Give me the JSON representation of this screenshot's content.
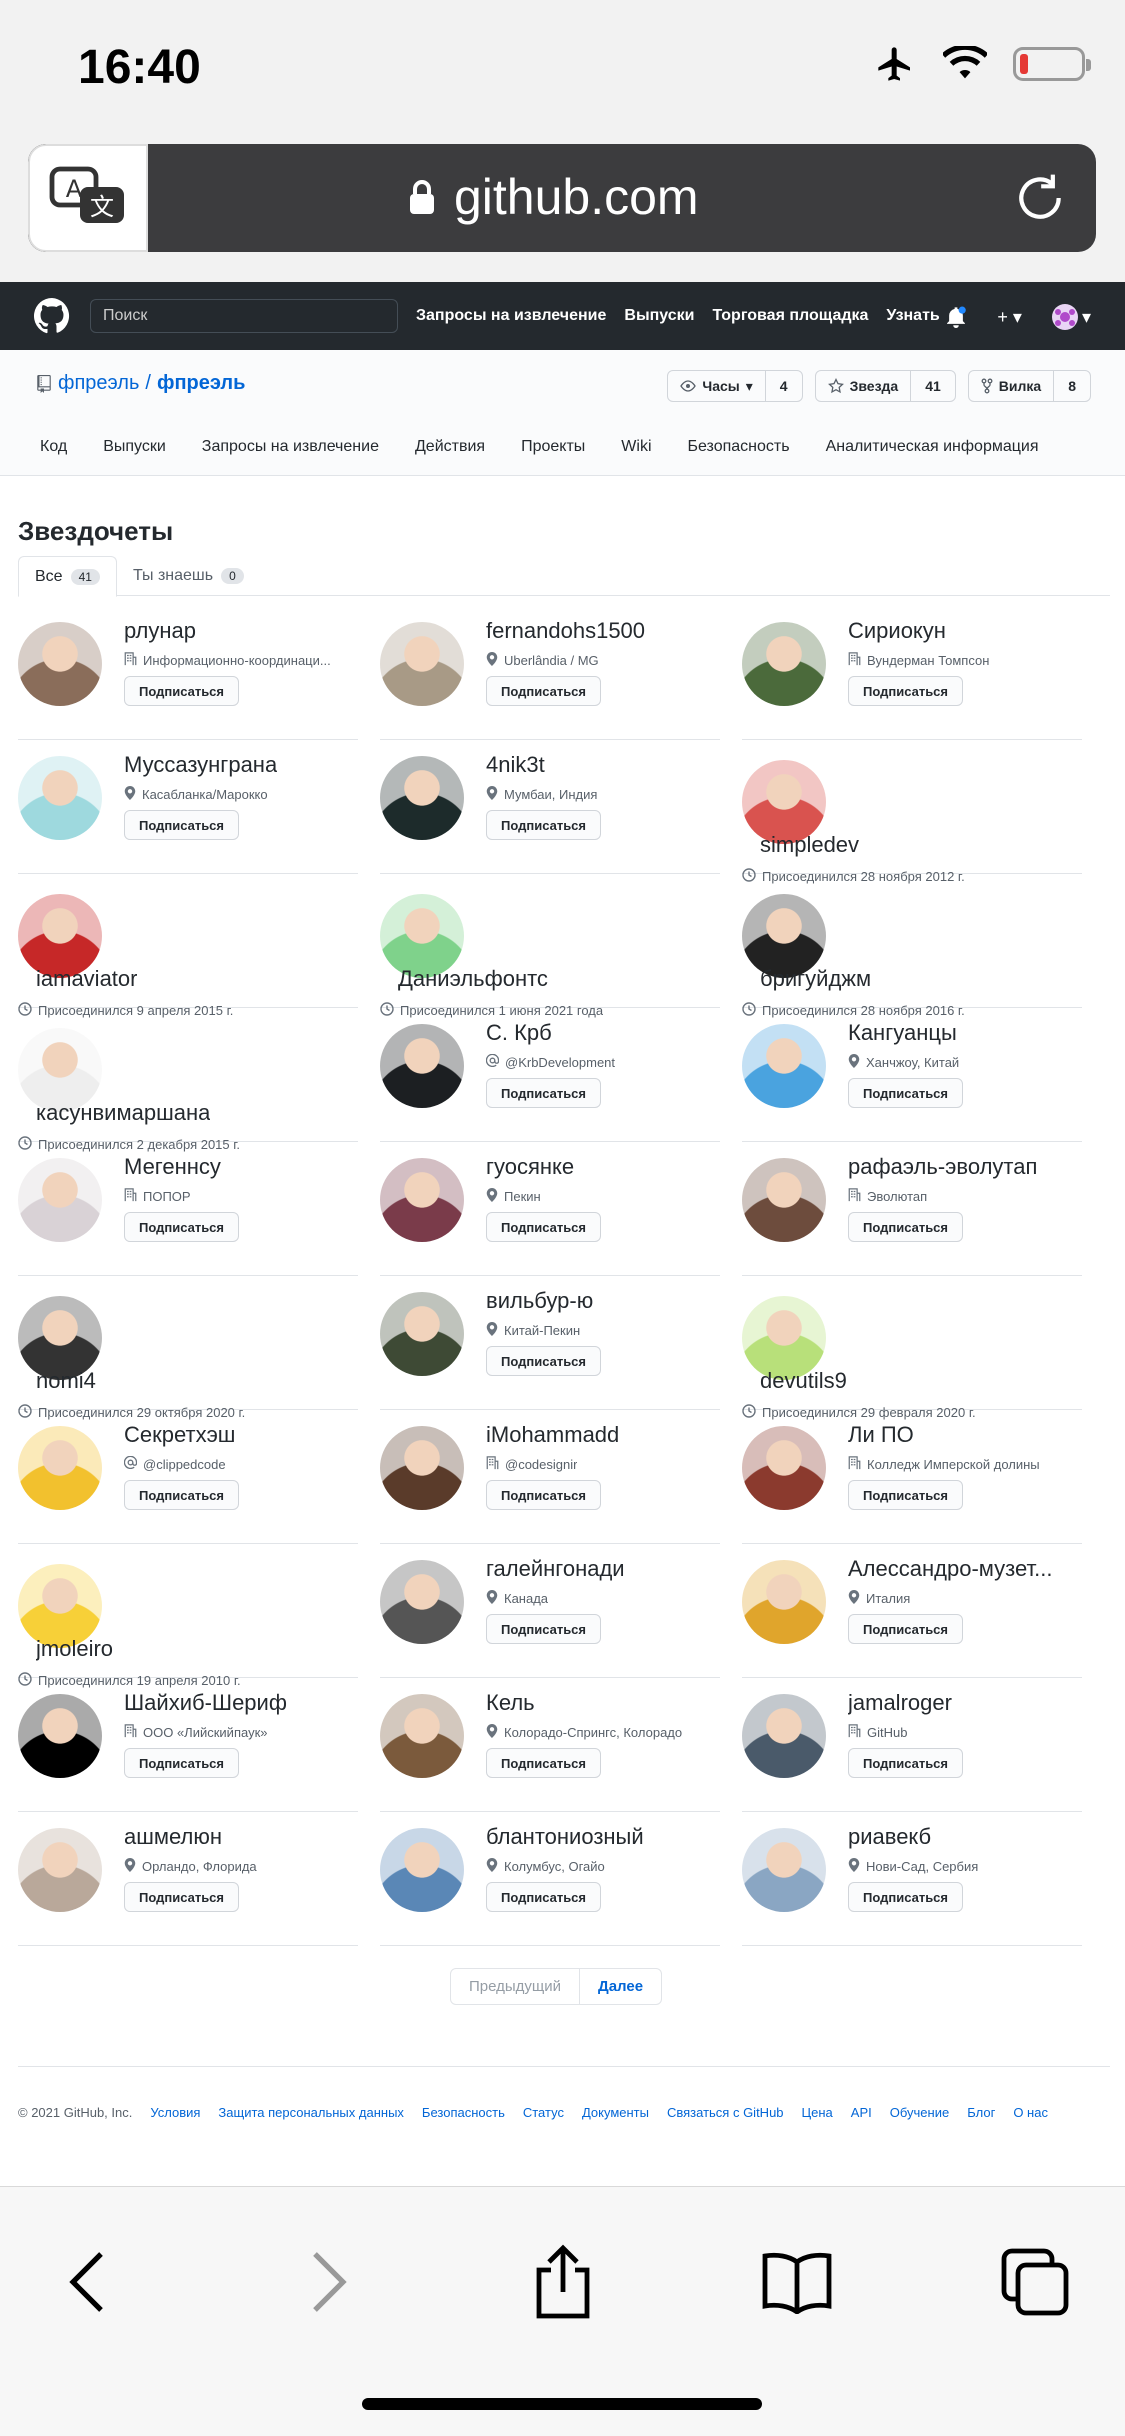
{
  "status": {
    "time": "16:40"
  },
  "browser": {
    "url": "github.com"
  },
  "gh": {
    "search_placeholder": "Поиск",
    "nav": [
      "Запросы на извлечение",
      "Выпуски",
      "Торговая площадка",
      "Узнать"
    ]
  },
  "repo": {
    "owner": "фпреэль",
    "sep": "/",
    "name": "фпреэль",
    "watch": {
      "label": "Часы",
      "count": "4"
    },
    "star": {
      "label": "Звезда",
      "count": "41"
    },
    "fork": {
      "label": "Вилка",
      "count": "8"
    },
    "tabs": [
      "Код",
      "Выпуски",
      "Запросы на извлечение",
      "Действия",
      "Проекты",
      "Wiki",
      "Безопасность",
      "Аналитическая информация"
    ]
  },
  "page": {
    "title": "Звездочеты",
    "tab_all": "Все",
    "tab_all_count": "41",
    "tab_known": "Ты знаешь",
    "tab_known_count": "0",
    "follow_label": "Подписаться"
  },
  "users": [
    {
      "name": "рлунар",
      "meta": "Информационно-координаци...",
      "meta_icon": "org",
      "color": "#8a6d5a"
    },
    {
      "name": "fernandohs1500",
      "meta": "Uberlândia / MG",
      "meta_icon": "loc",
      "color": "#a89a86"
    },
    {
      "name": "Сириокун",
      "meta": "Вундерман Томпсон",
      "meta_icon": "org",
      "color": "#4b6a3b"
    },
    {
      "name": "Муссазунграна",
      "meta": "Касабланка/Марокко",
      "meta_icon": "loc",
      "color": "#9ed9de"
    },
    {
      "name": "4nik3t",
      "meta": "Мумбаи, Индия",
      "meta_icon": "loc",
      "color": "#1d2b2b"
    },
    {
      "name": "simpledev",
      "meta": "Присоединился 28 ноября 2012 г.",
      "meta_icon": "clock",
      "color": "#d9534f"
    },
    {
      "name": "iamaviator",
      "meta": "Присоединился 9 апреля 2015 г.",
      "meta_icon": "clock",
      "color": "#c62828"
    },
    {
      "name": "Даниэльфонтс",
      "meta": "Присоединился 1 июня 2021 года",
      "meta_icon": "clock",
      "color": "#7fd28b"
    },
    {
      "name": "бригуйджм",
      "meta": "Присоединился 28 ноября 2016 г.",
      "meta_icon": "clock",
      "color": "#222222"
    },
    {
      "name": "касунвимаршана",
      "meta": "Присоединился 2 декабря 2015 г.",
      "meta_icon": "clock",
      "color": "#eeeeee"
    },
    {
      "name": "С. Крб",
      "meta": "@KrbDevelopment",
      "meta_icon": "at",
      "color": "#1c1f22"
    },
    {
      "name": "Кангуанцы",
      "meta": "Ханчжоу, Китай",
      "meta_icon": "loc",
      "color": "#4aa3df"
    },
    {
      "name": "Мегеннсу",
      "meta": "ПОПОР",
      "meta_icon": "org",
      "color": "#d9d2d6"
    },
    {
      "name": "гуосянке",
      "meta": "Пекин",
      "meta_icon": "loc",
      "color": "#7a3b4a"
    },
    {
      "name": "рафаэль-эволутап",
      "meta": "Эволютап",
      "meta_icon": "org",
      "color": "#6d4c3d"
    },
    {
      "name": "nomi4",
      "meta": "Присоединился 29 октября 2020 г.",
      "meta_icon": "clock",
      "color": "#333333"
    },
    {
      "name": "вильбур-ю",
      "meta": "Китай-Пекин",
      "meta_icon": "loc",
      "color": "#3e4a35"
    },
    {
      "name": "devutils9",
      "meta": "Присоединился 29 февраля 2020 г.",
      "meta_icon": "clock",
      "color": "#b8e07a"
    },
    {
      "name": "Секретхэш",
      "meta": "@clippedcode",
      "meta_icon": "at",
      "color": "#f2c12e"
    },
    {
      "name": "iMohammadd",
      "meta": "@codesignir",
      "meta_icon": "org",
      "color": "#5a3b2a"
    },
    {
      "name": "Ли ПО",
      "meta": "Колледж Имперской долины",
      "meta_icon": "org",
      "color": "#8b3a2e"
    },
    {
      "name": "jmoleiro",
      "meta": "Присоединился 19 апреля 2010 г.",
      "meta_icon": "clock",
      "color": "#f7d038"
    },
    {
      "name": "галейнгонади",
      "meta": "Канада",
      "meta_icon": "loc",
      "color": "#555555"
    },
    {
      "name": "Алессандро-музет...",
      "meta": "Италия",
      "meta_icon": "loc",
      "color": "#e0a52c"
    },
    {
      "name": "Шайхиб-Шериф",
      "meta": "ООО «Лийскийпаук»",
      "meta_icon": "org",
      "color": "#000000"
    },
    {
      "name": "Кель",
      "meta": "Колорадо-Спрингс, Колорадо",
      "meta_icon": "loc",
      "color": "#7b5a3c"
    },
    {
      "name": "jamalroger",
      "meta": "GitHub",
      "meta_icon": "org",
      "color": "#4a5a6a"
    },
    {
      "name": "ашмелюн",
      "meta": "Орландо, Флорида",
      "meta_icon": "loc",
      "color": "#b9a89a"
    },
    {
      "name": "блантониозный",
      "meta": "Колумбус, Огайо",
      "meta_icon": "loc",
      "color": "#5a87b6"
    },
    {
      "name": "риавекб",
      "meta": "Нови-Сад, Сербия",
      "meta_icon": "loc",
      "color": "#8aa6c3"
    }
  ],
  "pager": {
    "prev": "Предыдущий",
    "next": "Далее"
  },
  "footer": {
    "copy": "© 2021 GitHub, Inc.",
    "links": [
      "Условия",
      "Защита персональных данных",
      "Безопасность",
      "Статус",
      "Документы",
      "Связаться с GitHub",
      "Цена",
      "API",
      "Обучение",
      "Блог",
      "О нас"
    ]
  }
}
